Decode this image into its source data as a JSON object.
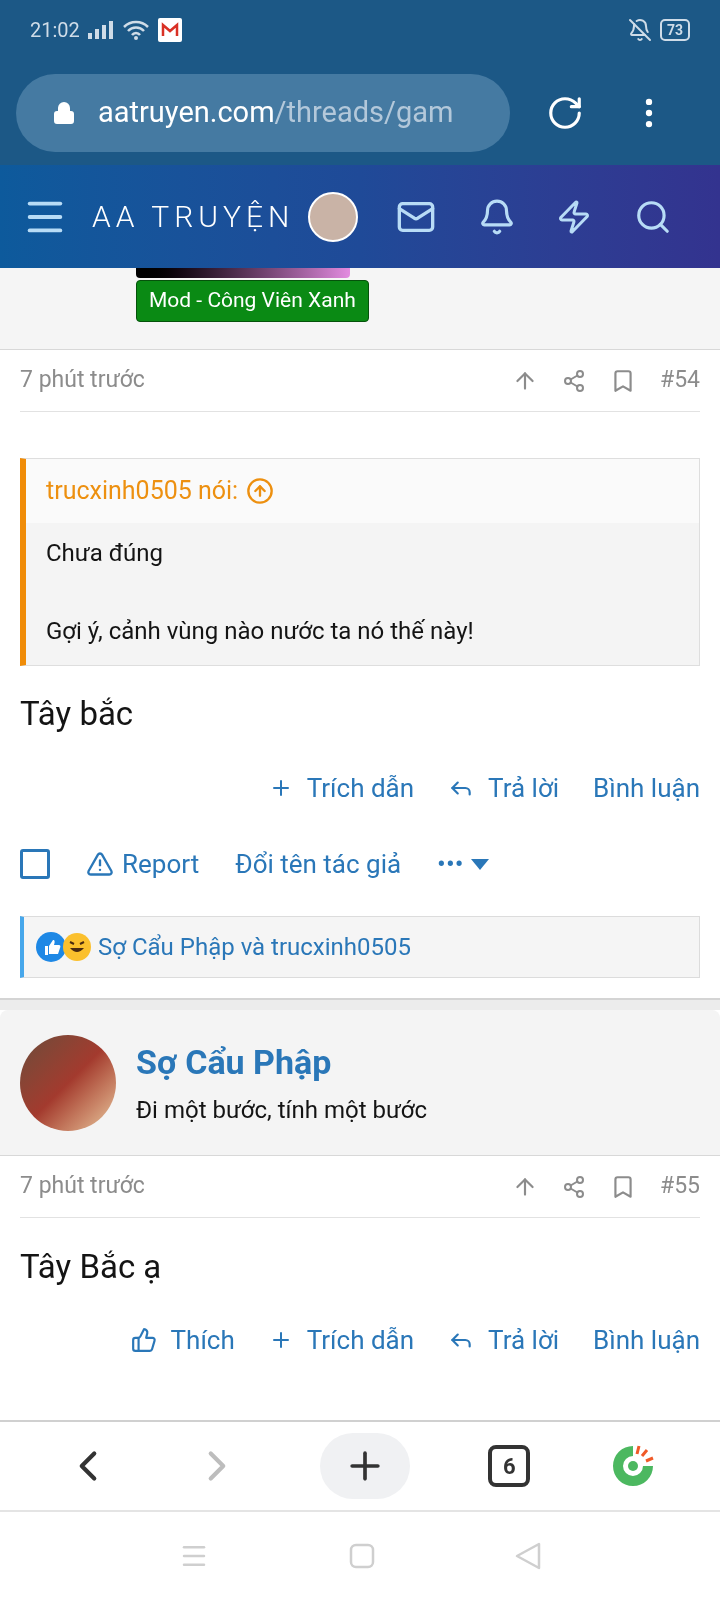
{
  "status_bar": {
    "time": "21:02",
    "battery": "73"
  },
  "browser": {
    "url_host": "aatruyen.com",
    "url_path": "/threads/gam",
    "tab_count": "6"
  },
  "site_header": {
    "logo": "AA TRUYỆN"
  },
  "posts": [
    {
      "user_badge": "Mod - Công Viên Xanh",
      "time": "7 phút trước",
      "number": "#54",
      "quote": {
        "author": "trucxinh0505 nói:",
        "lines": [
          "Chưa đúng",
          "Gợi ý, cảnh vùng nào nước ta nó thế này!"
        ]
      },
      "body": "Tây bắc",
      "actions": [
        {
          "kind": "quote",
          "label": "Trích dẫn"
        },
        {
          "kind": "reply",
          "label": "Trả lời"
        },
        {
          "kind": "comment",
          "label": "Bình luận"
        }
      ],
      "select_checked": false,
      "tools": [
        {
          "kind": "report",
          "label": "Report"
        },
        {
          "kind": "rename",
          "label": "Đổi tên tác giả"
        },
        {
          "kind": "more",
          "label": "•••"
        }
      ],
      "reactions": "Sợ Cẩu Phập và trucxinh0505"
    },
    {
      "user_name": "Sợ Cẩu Phập",
      "user_title": "Đi một bước, tính một bước",
      "time": "7 phút trước",
      "number": "#55",
      "body": "Tây Bắc ạ",
      "actions": [
        {
          "kind": "like",
          "label": "Thích"
        },
        {
          "kind": "quote",
          "label": "Trích dẫn"
        },
        {
          "kind": "reply",
          "label": "Trả lời"
        },
        {
          "kind": "comment",
          "label": "Bình luận"
        }
      ]
    }
  ]
}
